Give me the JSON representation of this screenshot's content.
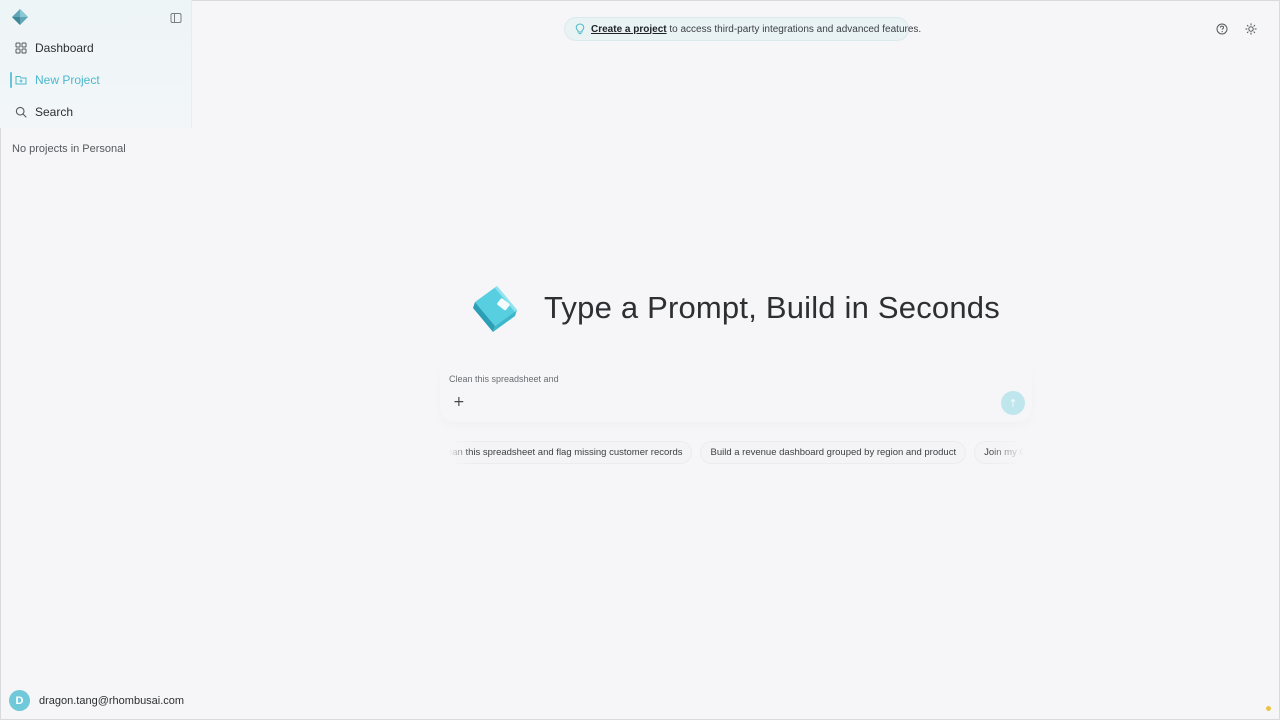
{
  "sidebar": {
    "logo": "rhombus-logo-icon",
    "collapse_icon": "sidebar-collapse-icon",
    "items": [
      {
        "label": "Dashboard",
        "icon": "grid-icon",
        "active": false
      },
      {
        "label": "New Project",
        "icon": "new-folder-icon",
        "active": true
      },
      {
        "label": "Search",
        "icon": "search-icon",
        "active": false
      }
    ],
    "empty_text": "No projects in Personal",
    "user": {
      "initial": "D",
      "email": "dragon.tang@rhombusai.com"
    }
  },
  "banner": {
    "icon": "lightbulb-icon",
    "link_text": "Create a project",
    "rest_text": "to access third-party integrations and advanced features."
  },
  "header_icons": [
    "help-icon",
    "theme-sun-icon"
  ],
  "hero": {
    "icon": "book-icon",
    "title": "Type a Prompt, Build in Seconds"
  },
  "prompt": {
    "value": "Clean this spreadsheet and",
    "add_label": "+",
    "send_label": "↑"
  },
  "suggestions": [
    "Clean this spreadsheet and flag missing customer records",
    "Build a revenue dashboard grouped by region and product",
    "Join my CRM export with billing data"
  ],
  "colors": {
    "accent": "#4bb8cc",
    "send_button": "#bfe6ec",
    "avatar": "#6fc9d8",
    "banner_bg": "#e9f3f4"
  }
}
